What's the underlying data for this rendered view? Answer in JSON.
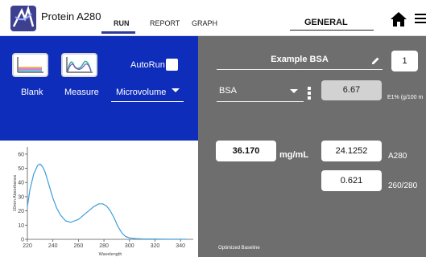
{
  "app": {
    "title": "Protein A280",
    "accent": "#0f2dbb",
    "panel_color": "#6e6e6e"
  },
  "tabs": [
    {
      "label": "RUN",
      "active": true
    },
    {
      "label": "REPORT",
      "active": false
    },
    {
      "label": "GRAPH",
      "active": false
    }
  ],
  "settings_tab": {
    "label": "GENERAL"
  },
  "icons": {
    "logo": "app-logo-icon",
    "home": "home-icon",
    "menu": "hamburger-menu-icon",
    "edit": "pencil-icon",
    "more": "kebab-icon"
  },
  "controls": {
    "blank_label": "Blank",
    "measure_label": "Measure",
    "autorun_label": "AutoRun",
    "autorun_checked": false,
    "mode_value": "Microvolume"
  },
  "sample": {
    "name": "Example BSA",
    "index": "1",
    "type_value": "BSA",
    "coefficient": "6.67",
    "coefficient_unit": "E1% (g/100 m"
  },
  "results": {
    "concentration": "36.170",
    "concentration_unit": "mg/mL",
    "a280_value": "24.1252",
    "a280_label": "A280",
    "ratio_value": "0.621",
    "ratio_label": "260/280",
    "baseline_note": "Optimized Baseline"
  },
  "chart_data": {
    "type": "line",
    "xlabel": "Wavelength",
    "ylabel": "10mm Absorbance",
    "xlim": [
      220,
      350
    ],
    "ylim": [
      0,
      65
    ],
    "xticks": [
      220,
      240,
      260,
      280,
      300,
      320,
      340
    ],
    "yticks": [
      0,
      10,
      20,
      30,
      40,
      50,
      60
    ],
    "line_color": "#3b9ddd",
    "series": [
      {
        "x": [
          220,
          222,
          225,
          228,
          230,
          232,
          234,
          236,
          238,
          240,
          243,
          246,
          250,
          254,
          257,
          260,
          264,
          268,
          272,
          276,
          279,
          282,
          285,
          288,
          291,
          294,
          297,
          300,
          305,
          310,
          320,
          330,
          340,
          345
        ],
        "values": [
          23,
          35,
          46,
          52,
          53,
          51,
          47,
          41,
          35,
          29,
          22,
          17,
          13,
          12,
          13,
          14,
          17,
          20,
          23,
          25,
          25,
          23.5,
          20,
          15,
          9,
          4.5,
          2,
          1,
          0.5,
          0.3,
          0.2,
          0.1,
          0.1,
          0.1
        ]
      }
    ]
  }
}
